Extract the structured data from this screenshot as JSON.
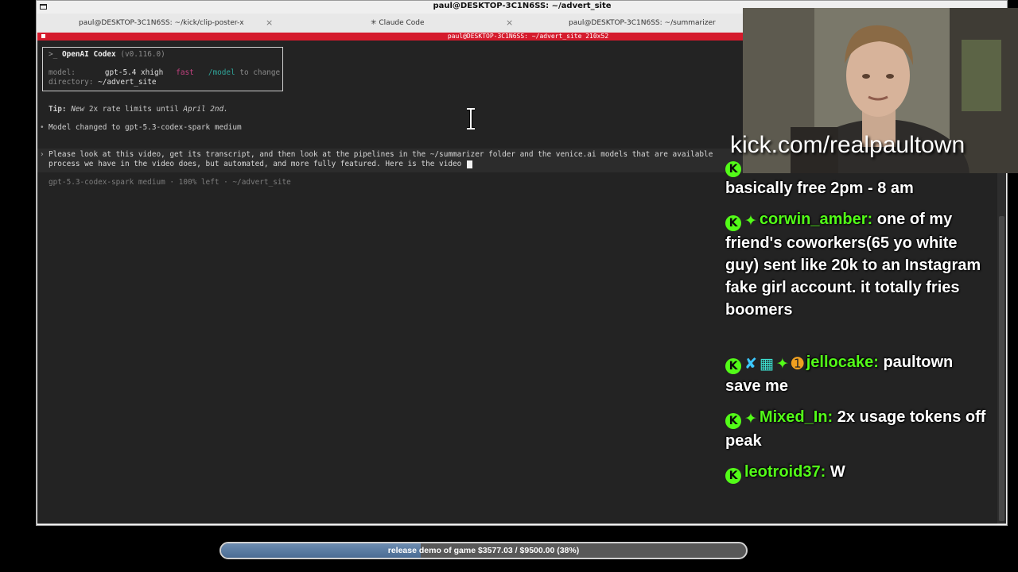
{
  "window": {
    "title": "paul@DESKTOP-3C1N6SS: ~/advert_site"
  },
  "tabs": [
    {
      "label": "paul@DESKTOP-3C1N6SS: ~/kick/clip-poster-x"
    },
    {
      "label": "✳ Claude Code"
    },
    {
      "label": "paul@DESKTOP-3C1N6SS: ~/summarizer"
    }
  ],
  "terminal": {
    "header": "paul@DESKTOP-3C1N6SS: ~/advert_site 210x52",
    "codex_box": {
      "prompt": ">_",
      "app_name": "OpenAI Codex",
      "version": "(v0.116.0)",
      "model_label": "model:",
      "model_value": "gpt-5.4 xhigh",
      "fast_tag": "fast",
      "model_command": "/model",
      "model_hint": "to change",
      "directory_label": "directory:",
      "directory_value": "~/advert_site"
    },
    "tip": {
      "label": "Tip:",
      "text_italic": "New",
      "text_mid": "2x rate limits until",
      "text_date": "April 2nd."
    },
    "model_changed": "Model changed to gpt-5.3-codex-spark medium",
    "user_line_1": "Please look at this video, get its transcript, and then look at the pipelines in the ~/summarizer folder and the venice.ai models that are available",
    "user_line_2": "process we have in the video does, but automated, and more fully featured. Here is the video",
    "status": "gpt-5.3-codex-spark medium · 100% left · ~/advert_site"
  },
  "overlay": {
    "kick_url": "kick.com/realpaultown",
    "chat": [
      {
        "username": "",
        "message": "basically free 2pm - 8 am"
      },
      {
        "username": "corwin_amber:",
        "message": "one of my friend's coworkers(65 yo white guy) sent like 20k to an Instagram fake girl account. it totally fries boomers"
      },
      {
        "username": "jellocake:",
        "message": "paultown save me"
      },
      {
        "username": "Mixed_In:",
        "message": "2x usage tokens off peak"
      },
      {
        "username": "leotroid37:",
        "message": "W"
      }
    ],
    "progress": {
      "label": "release demo of game $3577.03 / $9500.00 (38%)",
      "fraction": 0.38
    }
  },
  "colors": {
    "terminal_bg": "#232323",
    "header_red": "#d51a2c",
    "chat_username": "#53fc18",
    "fast_tag": "#c2417f",
    "model_command": "#2fa59a"
  }
}
